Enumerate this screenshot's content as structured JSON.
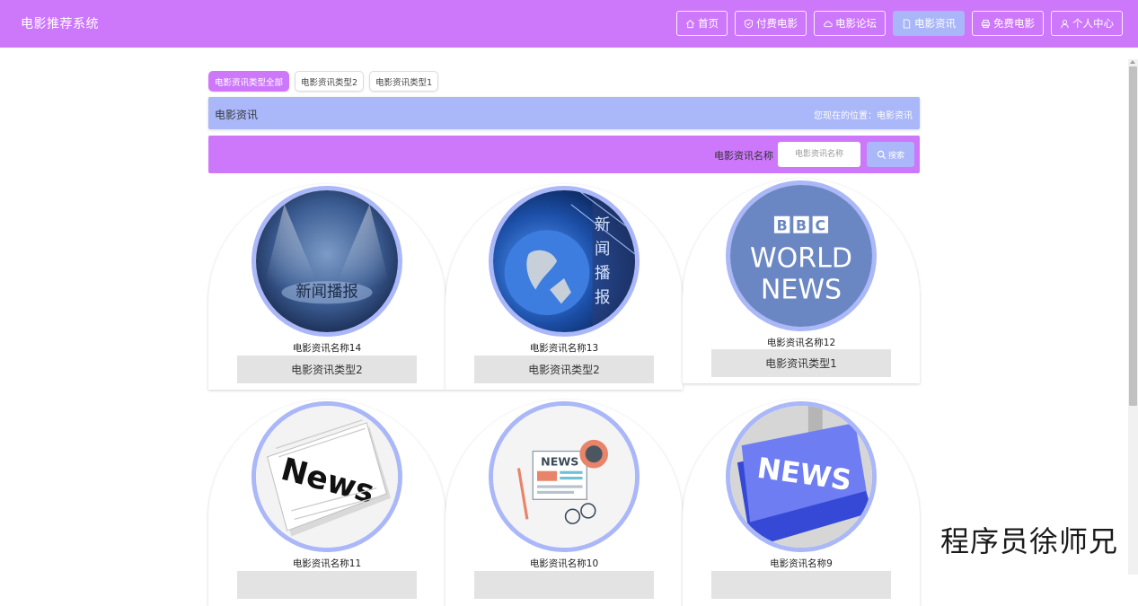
{
  "header": {
    "brand": "电影推荐系统",
    "nav": [
      {
        "label": "首页",
        "icon": "home-icon",
        "active": false
      },
      {
        "label": "付费电影",
        "icon": "shield-icon",
        "active": false
      },
      {
        "label": "电影论坛",
        "icon": "cloud-icon",
        "active": false
      },
      {
        "label": "电影资讯",
        "icon": "document-icon",
        "active": true
      },
      {
        "label": "免费电影",
        "icon": "printer-icon",
        "active": false
      },
      {
        "label": "个人中心",
        "icon": "user-icon",
        "active": false
      }
    ]
  },
  "tabs": [
    {
      "label": "电影资讯类型全部",
      "active": true
    },
    {
      "label": "电影资讯类型2",
      "active": false
    },
    {
      "label": "电影资讯类型1",
      "active": false
    }
  ],
  "breadcrumb": {
    "title": "电影资讯",
    "location": "您现在的位置：电影资讯"
  },
  "search": {
    "label": "电影资讯名称",
    "placeholder": "电影资讯名称",
    "button": "搜索"
  },
  "cards": [
    {
      "name": "电影资讯名称14",
      "type": "电影资讯类型2",
      "image_text": "新闻播报"
    },
    {
      "name": "电影资讯名称13",
      "type": "电影资讯类型2",
      "image_text": "新闻播报"
    },
    {
      "name": "电影资讯名称12",
      "type": "电影资讯类型1",
      "image_text": "BBC WORLD NEWS"
    },
    {
      "name": "电影资讯名称11",
      "type": "",
      "image_text": "News"
    },
    {
      "name": "电影资讯名称10",
      "type": "",
      "image_text": "NEWS"
    },
    {
      "name": "电影资讯名称9",
      "type": "",
      "image_text": "NEWS"
    }
  ],
  "watermark": "程序员徐师兄",
  "colors": {
    "primary": "#cd78fb",
    "secondary": "#aab7f8"
  }
}
